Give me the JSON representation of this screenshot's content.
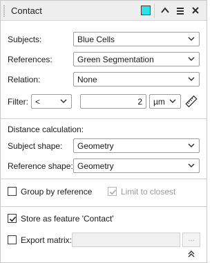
{
  "panel": {
    "title": "Contact",
    "swatch_color": "#22e6e8",
    "buttons": {
      "collapse": "chevron-up-icon",
      "menu": "hamburger-menu-icon",
      "close": "close-icon"
    }
  },
  "selection": {
    "subjects": {
      "label": "Subjects:",
      "value": "Blue Cells"
    },
    "references": {
      "label": "References:",
      "value": "Green Segmentation"
    },
    "relation": {
      "label": "Relation:",
      "value": "None"
    },
    "filter": {
      "label": "Filter:",
      "operator": "<",
      "value": "2",
      "unit": "µm",
      "tool_icon": "ruler-icon"
    }
  },
  "distance": {
    "heading": "Distance calculation:",
    "subject_shape": {
      "label": "Subject shape:",
      "value": "Geometry"
    },
    "reference_shape": {
      "label": "Reference shape:",
      "value": "Geometry"
    }
  },
  "grouping": {
    "group_by_reference": {
      "label": "Group by reference",
      "checked": false
    },
    "limit_to_closest": {
      "label": "Limit to closest",
      "checked": true,
      "enabled": false
    }
  },
  "output": {
    "store_feature": {
      "label": "Store as feature 'Contact'",
      "checked": true
    },
    "export_matrix": {
      "label": "Export matrix:",
      "checked": false,
      "path": "",
      "browse_label": "..."
    }
  },
  "footer": {
    "expand_icon": "double-chevron-up-icon"
  }
}
